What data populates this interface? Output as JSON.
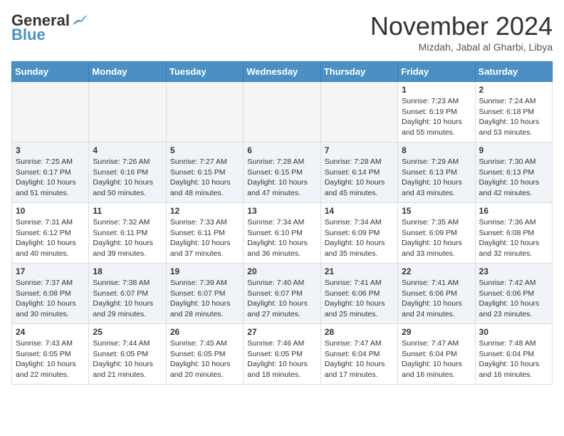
{
  "header": {
    "logo_line1": "General",
    "logo_line2": "Blue",
    "month": "November 2024",
    "location": "Mizdah, Jabal al Gharbi, Libya"
  },
  "weekdays": [
    "Sunday",
    "Monday",
    "Tuesday",
    "Wednesday",
    "Thursday",
    "Friday",
    "Saturday"
  ],
  "weeks": [
    [
      {
        "day": "",
        "info": ""
      },
      {
        "day": "",
        "info": ""
      },
      {
        "day": "",
        "info": ""
      },
      {
        "day": "",
        "info": ""
      },
      {
        "day": "",
        "info": ""
      },
      {
        "day": "1",
        "info": "Sunrise: 7:23 AM\nSunset: 6:19 PM\nDaylight: 10 hours\nand 55 minutes."
      },
      {
        "day": "2",
        "info": "Sunrise: 7:24 AM\nSunset: 6:18 PM\nDaylight: 10 hours\nand 53 minutes."
      }
    ],
    [
      {
        "day": "3",
        "info": "Sunrise: 7:25 AM\nSunset: 6:17 PM\nDaylight: 10 hours\nand 51 minutes."
      },
      {
        "day": "4",
        "info": "Sunrise: 7:26 AM\nSunset: 6:16 PM\nDaylight: 10 hours\nand 50 minutes."
      },
      {
        "day": "5",
        "info": "Sunrise: 7:27 AM\nSunset: 6:15 PM\nDaylight: 10 hours\nand 48 minutes."
      },
      {
        "day": "6",
        "info": "Sunrise: 7:28 AM\nSunset: 6:15 PM\nDaylight: 10 hours\nand 47 minutes."
      },
      {
        "day": "7",
        "info": "Sunrise: 7:28 AM\nSunset: 6:14 PM\nDaylight: 10 hours\nand 45 minutes."
      },
      {
        "day": "8",
        "info": "Sunrise: 7:29 AM\nSunset: 6:13 PM\nDaylight: 10 hours\nand 43 minutes."
      },
      {
        "day": "9",
        "info": "Sunrise: 7:30 AM\nSunset: 6:13 PM\nDaylight: 10 hours\nand 42 minutes."
      }
    ],
    [
      {
        "day": "10",
        "info": "Sunrise: 7:31 AM\nSunset: 6:12 PM\nDaylight: 10 hours\nand 40 minutes."
      },
      {
        "day": "11",
        "info": "Sunrise: 7:32 AM\nSunset: 6:11 PM\nDaylight: 10 hours\nand 39 minutes."
      },
      {
        "day": "12",
        "info": "Sunrise: 7:33 AM\nSunset: 6:11 PM\nDaylight: 10 hours\nand 37 minutes."
      },
      {
        "day": "13",
        "info": "Sunrise: 7:34 AM\nSunset: 6:10 PM\nDaylight: 10 hours\nand 36 minutes."
      },
      {
        "day": "14",
        "info": "Sunrise: 7:34 AM\nSunset: 6:09 PM\nDaylight: 10 hours\nand 35 minutes."
      },
      {
        "day": "15",
        "info": "Sunrise: 7:35 AM\nSunset: 6:09 PM\nDaylight: 10 hours\nand 33 minutes."
      },
      {
        "day": "16",
        "info": "Sunrise: 7:36 AM\nSunset: 6:08 PM\nDaylight: 10 hours\nand 32 minutes."
      }
    ],
    [
      {
        "day": "17",
        "info": "Sunrise: 7:37 AM\nSunset: 6:08 PM\nDaylight: 10 hours\nand 30 minutes."
      },
      {
        "day": "18",
        "info": "Sunrise: 7:38 AM\nSunset: 6:07 PM\nDaylight: 10 hours\nand 29 minutes."
      },
      {
        "day": "19",
        "info": "Sunrise: 7:39 AM\nSunset: 6:07 PM\nDaylight: 10 hours\nand 28 minutes."
      },
      {
        "day": "20",
        "info": "Sunrise: 7:40 AM\nSunset: 6:07 PM\nDaylight: 10 hours\nand 27 minutes."
      },
      {
        "day": "21",
        "info": "Sunrise: 7:41 AM\nSunset: 6:06 PM\nDaylight: 10 hours\nand 25 minutes."
      },
      {
        "day": "22",
        "info": "Sunrise: 7:41 AM\nSunset: 6:06 PM\nDaylight: 10 hours\nand 24 minutes."
      },
      {
        "day": "23",
        "info": "Sunrise: 7:42 AM\nSunset: 6:06 PM\nDaylight: 10 hours\nand 23 minutes."
      }
    ],
    [
      {
        "day": "24",
        "info": "Sunrise: 7:43 AM\nSunset: 6:05 PM\nDaylight: 10 hours\nand 22 minutes."
      },
      {
        "day": "25",
        "info": "Sunrise: 7:44 AM\nSunset: 6:05 PM\nDaylight: 10 hours\nand 21 minutes."
      },
      {
        "day": "26",
        "info": "Sunrise: 7:45 AM\nSunset: 6:05 PM\nDaylight: 10 hours\nand 20 minutes."
      },
      {
        "day": "27",
        "info": "Sunrise: 7:46 AM\nSunset: 6:05 PM\nDaylight: 10 hours\nand 18 minutes."
      },
      {
        "day": "28",
        "info": "Sunrise: 7:47 AM\nSunset: 6:04 PM\nDaylight: 10 hours\nand 17 minutes."
      },
      {
        "day": "29",
        "info": "Sunrise: 7:47 AM\nSunset: 6:04 PM\nDaylight: 10 hours\nand 16 minutes."
      },
      {
        "day": "30",
        "info": "Sunrise: 7:48 AM\nSunset: 6:04 PM\nDaylight: 10 hours\nand 16 minutes."
      }
    ]
  ]
}
